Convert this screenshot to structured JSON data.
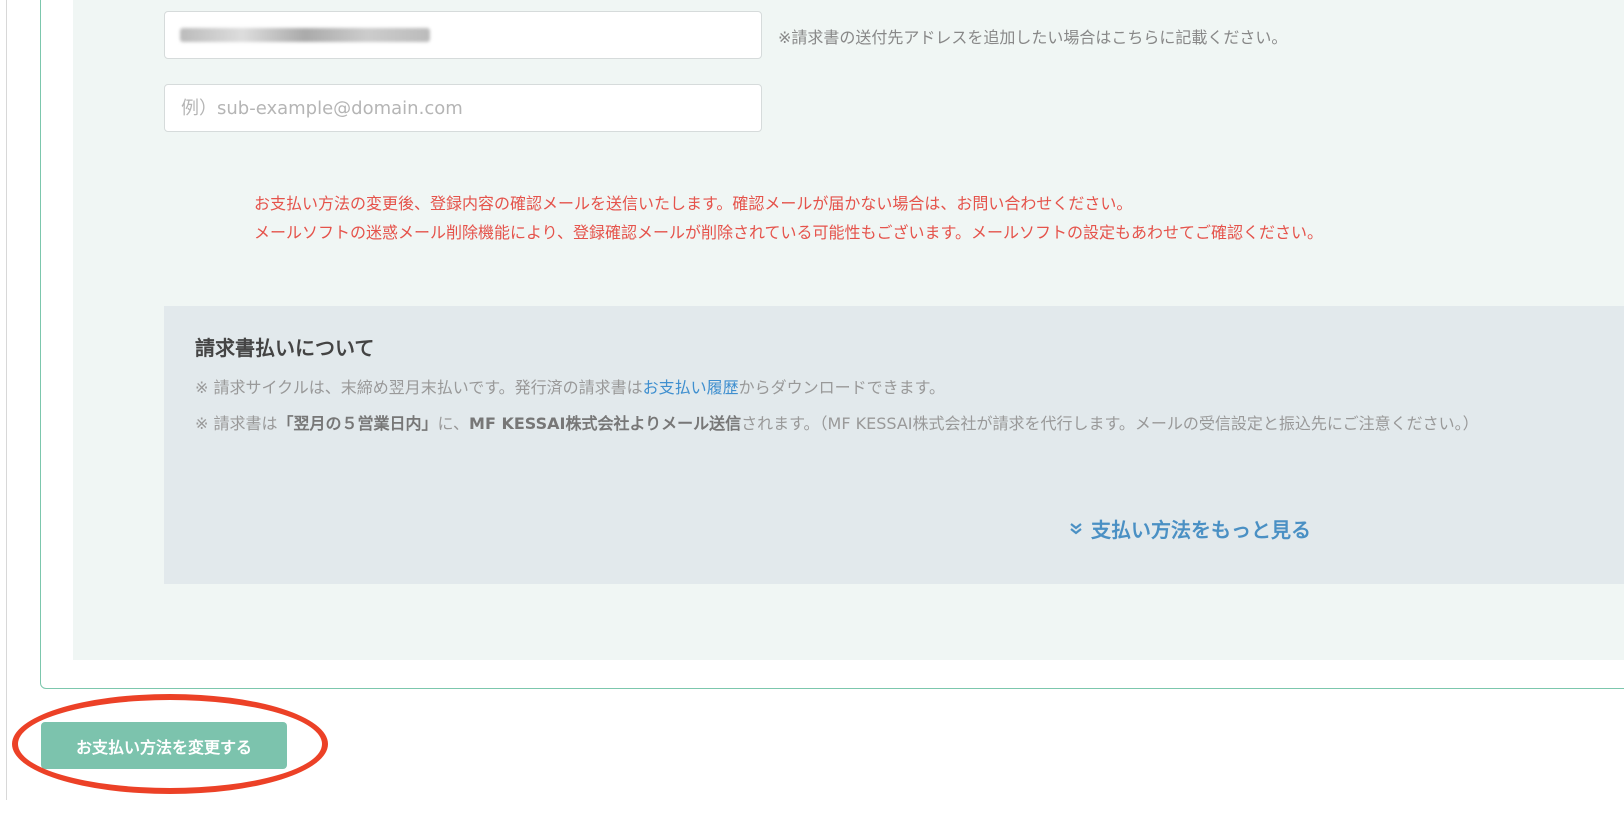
{
  "email": {
    "primary_value": "",
    "sub_placeholder": "例）sub-example@domain.com",
    "hint": "※請求書の送付先アドレスを追加したい場合はこちらに記載ください。"
  },
  "notice": {
    "line1": "お支払い方法の変更後、登録内容の確認メールを送信いたします。確認メールが届かない場合は、お問い合わせください。",
    "line2": "メールソフトの迷惑メール削除機能により、登録確認メールが削除されている可能性もございます。メールソフトの設定もあわせてご確認ください。"
  },
  "invoice_info": {
    "title": "請求書払いについて",
    "line1_prefix": "※ 請求サイクルは、末締め翌月末払いです。発行済の請求書は",
    "line1_link": "お支払い履歴",
    "line1_suffix": "からダウンロードできます。",
    "line2_prefix": "※ 請求書は",
    "line2_bold1": "「翌月の５営業日内」",
    "line2_mid": "に、",
    "line2_bold2": "MF KESSAI株式会社よりメール送信",
    "line2_suffix": "されます。（MF KESSAI株式会社が請求を代行します。メールの受信設定と振込先にご注意ください。）",
    "more_label": "支払い方法をもっと見る"
  },
  "submit_label": "お支払い方法を変更する",
  "colors": {
    "accent": "#7cc3ad",
    "notice_red": "#e5534b",
    "link_blue": "#3f8fcf",
    "highlight": "#ec4127"
  }
}
